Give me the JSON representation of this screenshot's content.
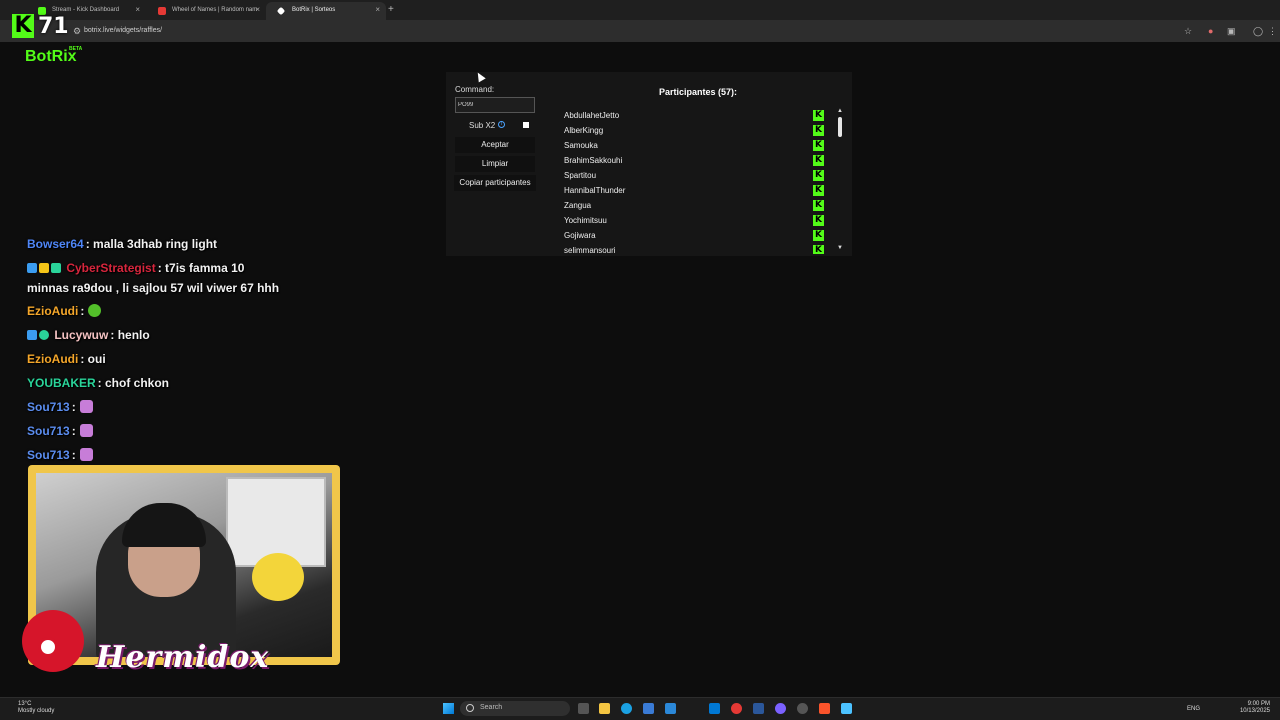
{
  "browser": {
    "tabs": [
      {
        "title": "Stream - Kick Dashboard",
        "favicon_color": "#53fc18"
      },
      {
        "title": "Wheel of Names | Random nam",
        "favicon_color": "#e53935"
      },
      {
        "title": "BotRix | Sorteos",
        "favicon_color": "#ffffff"
      }
    ],
    "new_tab": "+",
    "close_glyph": "×",
    "url": "botrix.live/widgets/raffles/"
  },
  "kick": {
    "logo": "K",
    "viewer_count": "71"
  },
  "botrix": {
    "brand": "BotRix",
    "brand_tag": "BETA",
    "command_label": "Command:",
    "command_value": "PO99",
    "sub_label": "Sub X2",
    "sub_info": "i",
    "accept_label": "Aceptar",
    "clear_label": "Limpiar",
    "copy_label": "Copiar participantes",
    "participants_title": "Participantes (57):",
    "participant_icon": "K",
    "participants": [
      "AbdullahetJetto",
      "AlberKingg",
      "Samouka",
      "BrahimSakkouhi",
      "Spartitou",
      "HannibalThunder",
      "Zangua",
      "Yochimitsuu",
      "Gojiwara",
      "selimmansouri"
    ],
    "scroll_up": "▲",
    "scroll_down": "▼"
  },
  "chat": [
    {
      "user": "Bowser64",
      "color": "#4f86f7",
      "text": ": malla 3dhab ring light"
    },
    {
      "user": "CyberStrategist",
      "color": "#d7263d",
      "text": ": t7is famma 10"
    },
    {
      "user": "",
      "color": "#f2f2f2",
      "text": "minnas ra9dou , li sajlou 57 wil viwer 67 hhh"
    },
    {
      "user": "EzioAudi",
      "color": "#f4a62a",
      "text": ":"
    },
    {
      "user": "Lucywuw",
      "color": "#f4c2c2",
      "text": ": henlo"
    },
    {
      "user": "EzioAudi",
      "color": "#f4a62a",
      "text": ": oui"
    },
    {
      "user": "YOUBAKER",
      "color": "#2ad49a",
      "text": ": chof chkon"
    },
    {
      "user": "Sou713",
      "color": "#5b8def",
      "text": ":"
    },
    {
      "user": "Sou713",
      "color": "#5b8def",
      "text": ":"
    },
    {
      "user": "Sou713",
      "color": "#5b8def",
      "text": ":"
    }
  ],
  "webcam": {
    "name": "Hermidox"
  },
  "taskbar": {
    "weather_temp": "13°C",
    "weather_desc": "Mostly cloudy",
    "search_placeholder": "Search",
    "language": "ENG",
    "time": "9:00 PM",
    "date": "10/13/2025"
  }
}
